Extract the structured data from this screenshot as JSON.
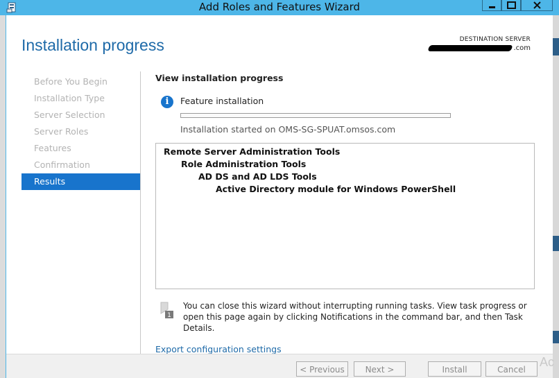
{
  "window": {
    "title": "Add Roles and Features Wizard",
    "controls": [
      "minimize",
      "maximize",
      "close"
    ],
    "accent_color": "#4db6e8"
  },
  "header": {
    "page_title": "Installation progress",
    "destination_label": "DESTINATION SERVER",
    "destination_value_suffix": ".com"
  },
  "nav": {
    "items": [
      {
        "label": "Before You Begin",
        "state": "disabled"
      },
      {
        "label": "Installation Type",
        "state": "disabled"
      },
      {
        "label": "Server Selection",
        "state": "disabled"
      },
      {
        "label": "Server Roles",
        "state": "disabled"
      },
      {
        "label": "Features",
        "state": "disabled"
      },
      {
        "label": "Confirmation",
        "state": "disabled"
      },
      {
        "label": "Results",
        "state": "active"
      }
    ],
    "active_color": "#1874cc"
  },
  "content": {
    "section_heading": "View installation progress",
    "status": {
      "icon": "info-icon",
      "label": "Feature installation",
      "progress_fraction": 0,
      "started_text": "Installation started on OMS-SG-SPUAT.omsos.com"
    },
    "results_tree": [
      {
        "label": "Remote Server Administration Tools",
        "level": 0
      },
      {
        "label": "Role Administration Tools",
        "level": 1
      },
      {
        "label": "AD DS and AD LDS Tools",
        "level": 2
      },
      {
        "label": "Active Directory module for Windows PowerShell",
        "level": 3
      }
    ],
    "note": "You can close this wizard without interrupting running tasks. View task progress or open this page again by clicking Notifications in the command bar, and then Task Details.",
    "export_link": "Export configuration settings"
  },
  "footer": {
    "previous": "< Previous",
    "next": "Next >",
    "install": "Install",
    "cancel": "Cancel"
  },
  "watermark": "Ac"
}
